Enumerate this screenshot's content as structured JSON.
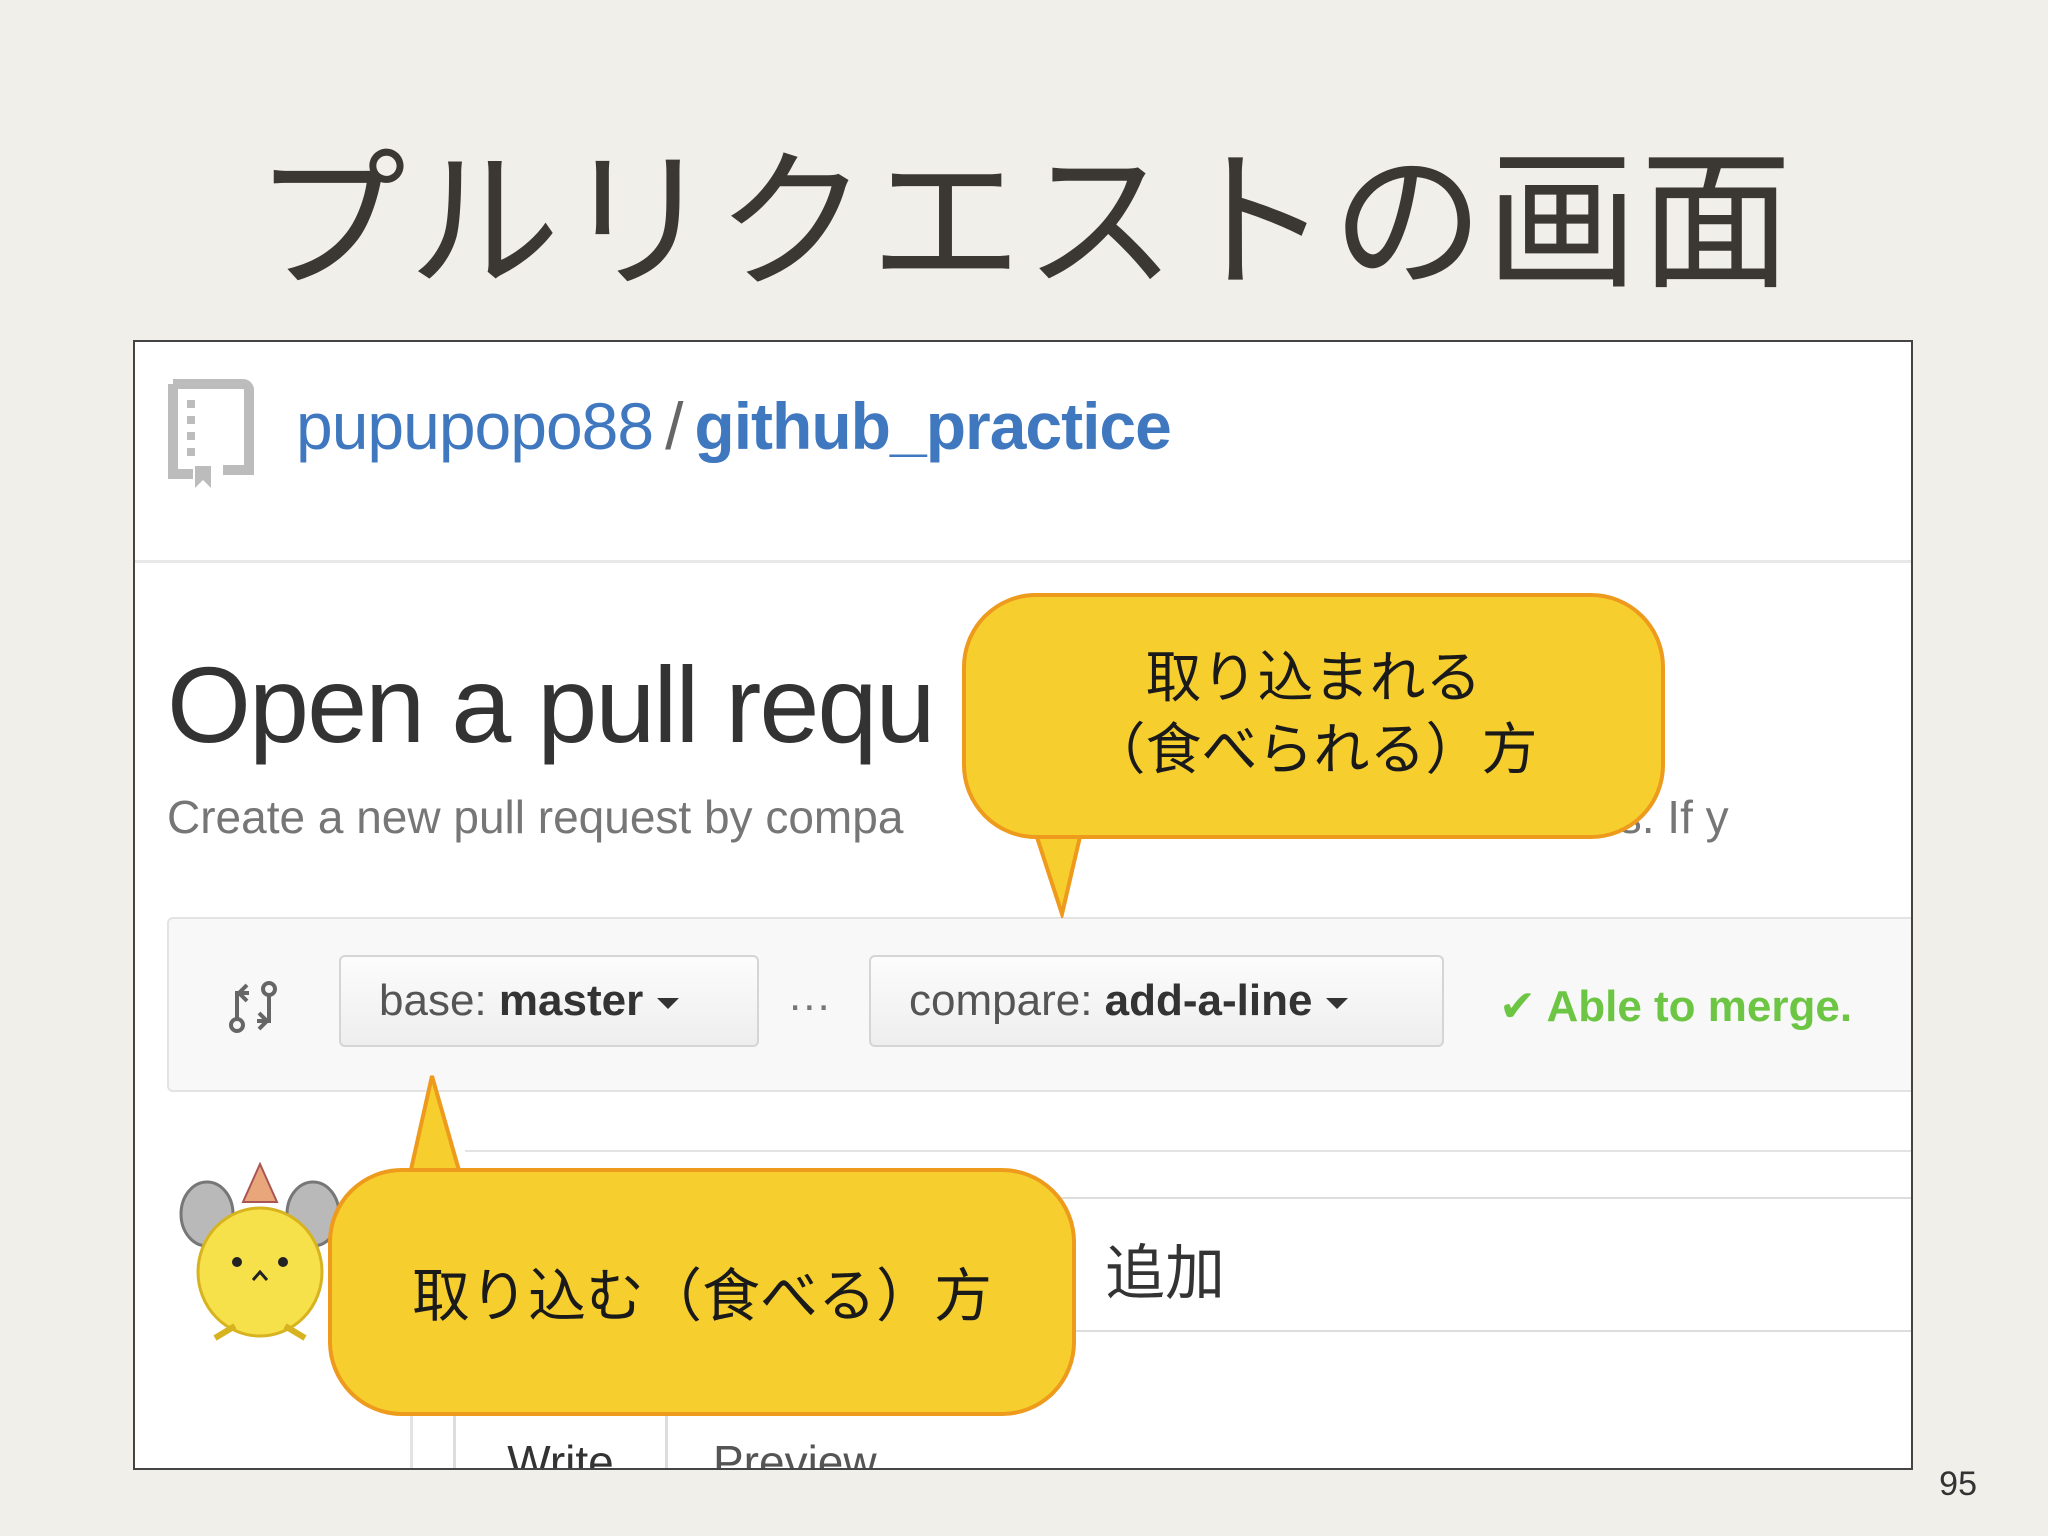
{
  "slide": {
    "title": "プルリクエストの画面",
    "page_number": "95"
  },
  "repo": {
    "owner": "pupupopo88",
    "separator": "/",
    "name": "github_practice"
  },
  "pull_request": {
    "heading": "Open a pull requ",
    "subtitle": "Create a new pull request by compa",
    "subtitle_tail": "anches. If y",
    "base_label": "base:",
    "base_value": "master",
    "ellipsis": "...",
    "compare_label": "compare:",
    "compare_value": "add-a-line",
    "merge_status": "✔ Able to merge.",
    "title_value": "追加",
    "tab_write": "Write",
    "tab_preview": "Preview"
  },
  "callouts": {
    "top_line1": "取り込まれる",
    "top_line2": "（食べられる）方",
    "bottom": "取り込む（食べる）方"
  },
  "colors": {
    "callout_fill": "#f6cf2e",
    "callout_border": "#ee9a1c",
    "link_blue": "#4078c0",
    "merge_green": "#6cc644"
  }
}
